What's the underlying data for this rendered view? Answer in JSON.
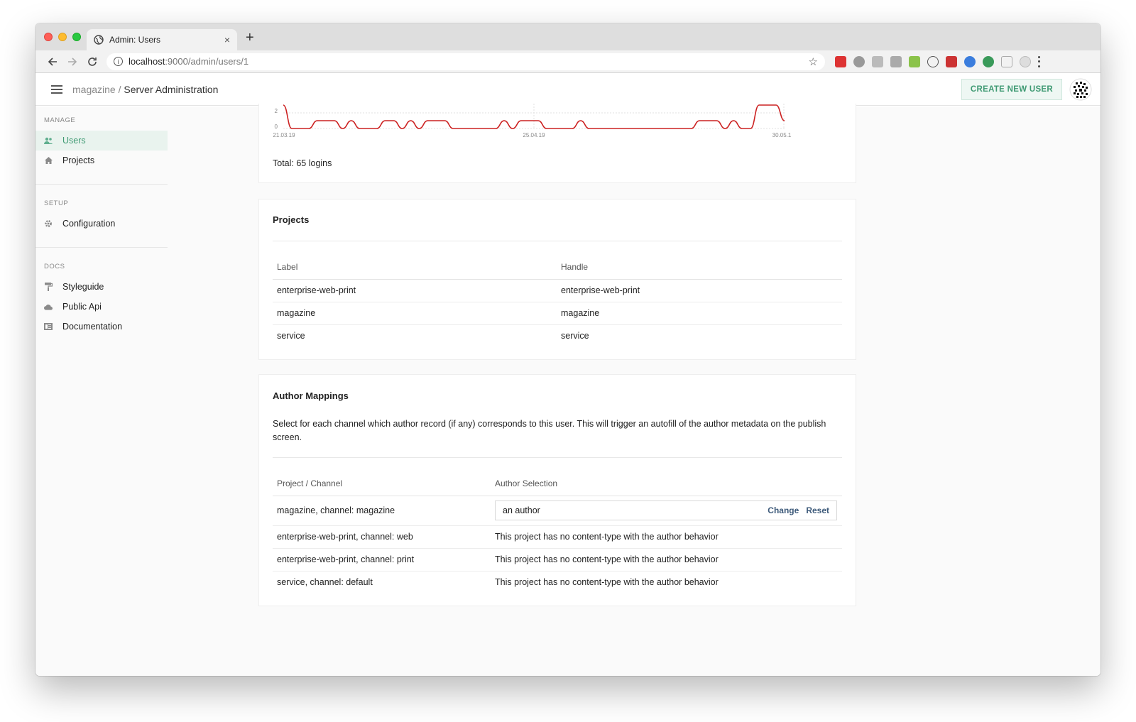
{
  "browser": {
    "tab_title": "Admin: Users",
    "new_tab_symbol": "+",
    "close_symbol": "×",
    "url_host": "localhost",
    "url_path": ":9000/admin/users/1"
  },
  "header": {
    "breadcrumb_project": "magazine",
    "breadcrumb_separator": " / ",
    "breadcrumb_current": "Server Administration",
    "create_button": "CREATE NEW USER"
  },
  "sidebar": {
    "groups": [
      {
        "title": "MANAGE",
        "items": [
          {
            "label": "Users",
            "icon": "users-icon",
            "active": true
          },
          {
            "label": "Projects",
            "icon": "home-icon"
          }
        ]
      },
      {
        "title": "SETUP",
        "items": [
          {
            "label": "Configuration",
            "icon": "gear-icon"
          }
        ]
      },
      {
        "title": "DOCS",
        "items": [
          {
            "label": "Styleguide",
            "icon": "paint-roller-icon"
          },
          {
            "label": "Public Api",
            "icon": "cloud-icon"
          },
          {
            "label": "Documentation",
            "icon": "book-icon"
          }
        ]
      }
    ]
  },
  "login_chart": {
    "y_ticks": [
      "2",
      "0"
    ],
    "x_ticks": [
      "21.03.19",
      "25.04.19",
      "30.05.1"
    ],
    "total": "Total: 65 logins",
    "color": "#cc2222"
  },
  "chart_data": {
    "type": "line",
    "x_ticks": [
      "21.03.19",
      "25.04.19",
      "30.05.1"
    ],
    "ylim": [
      0,
      3
    ],
    "series": [
      {
        "values": [
          3,
          0,
          0,
          0,
          1,
          1,
          1,
          0,
          1,
          0,
          0,
          0,
          1,
          1,
          0,
          1,
          0,
          1,
          1,
          1,
          0,
          0,
          0,
          0,
          0,
          0,
          1,
          0,
          1,
          1,
          1,
          0,
          0,
          0,
          0,
          1,
          0,
          0,
          0,
          0,
          0,
          0,
          0,
          0,
          0,
          0,
          0,
          0,
          0,
          1,
          1,
          1,
          0,
          1,
          0,
          0,
          3,
          3,
          3,
          1
        ]
      }
    ]
  },
  "projects": {
    "title": "Projects",
    "columns": [
      "Label",
      "Handle"
    ],
    "rows": [
      [
        "enterprise-web-print",
        "enterprise-web-print"
      ],
      [
        "magazine",
        "magazine"
      ],
      [
        "service",
        "service"
      ]
    ]
  },
  "author_mappings": {
    "title": "Author Mappings",
    "description": "Select for each channel which author record (if any) corresponds to this user. This will trigger an autofill of the author metadata on the publish screen.",
    "columns": [
      "Project / Channel",
      "Author Selection"
    ],
    "selected_row": {
      "channel": "magazine, channel: magazine",
      "value": "an author",
      "change": "Change",
      "reset": "Reset"
    },
    "rows": [
      {
        "channel": "enterprise-web-print, channel: web",
        "note": "This project has no content-type with the author behavior"
      },
      {
        "channel": "enterprise-web-print, channel: print",
        "note": "This project has no content-type with the author behavior"
      },
      {
        "channel": "service, channel: default",
        "note": "This project has no content-type with the author behavior"
      }
    ]
  }
}
